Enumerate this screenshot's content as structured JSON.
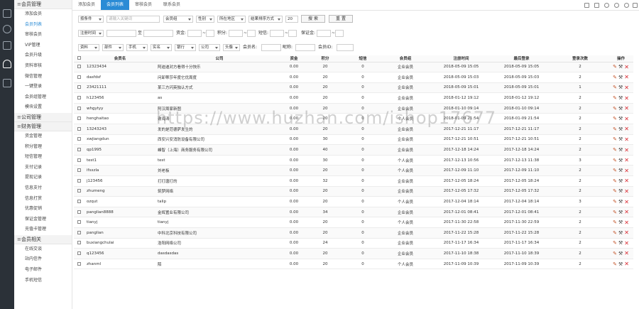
{
  "sidebar": {
    "groups": [
      {
        "label": "会员管理",
        "items": [
          "添加会员",
          "会员列表",
          "审核会员",
          "VIP管理",
          "会员升级",
          "资料审核",
          "微信管理",
          "一键登录",
          "会员组管理",
          "模块设置"
        ]
      },
      {
        "label": "公司管理",
        "items": []
      },
      {
        "label": "财务管理",
        "items": [
          "资金管理",
          "积分管理",
          "短信管理",
          "支付记录",
          "提现记录",
          "信息支付",
          "信息打赏",
          "优惠促销",
          "保证金管理",
          "充值卡管理"
        ]
      },
      {
        "label": "会员相关",
        "items": [
          "在线交谈",
          "站内信件",
          "电子邮件",
          "手机短信"
        ]
      }
    ],
    "active_item": "会员列表"
  },
  "topbar": {
    "tabs": [
      "添加会员",
      "会员列表",
      "审核会员",
      "联系会员"
    ],
    "active_tab": "会员列表",
    "icons": [
      "home-icon",
      "open-icon",
      "refresh-icon",
      "search-icon",
      "help-icon",
      "exit-icon"
    ]
  },
  "filters": {
    "row1": {
      "condition": "按条件",
      "keyword_placeholder": "请输入关键词",
      "group": "会员组",
      "gender": "性别",
      "region": "所在地区",
      "sort": "结果排序方式",
      "pagesize": "20",
      "search_btn": "搜 索",
      "reset_btn": "重 置"
    },
    "row2": {
      "time": "注册时间",
      "to": "至",
      "funds": "资金:",
      "points": "积分:",
      "sms": "短信:",
      "deposit": "保证金:",
      "tilde": "~"
    },
    "row3": {
      "selects": [
        "资料",
        "部件",
        "手机",
        "实名",
        "银行",
        "公司",
        "头像"
      ],
      "member_name": "会员名:",
      "nickname": "昵称:",
      "member_id": "会员ID:"
    }
  },
  "table": {
    "headers": [
      "",
      "会员名",
      "公司",
      "资金",
      "积分",
      "短信",
      "会员组",
      "注册时间",
      "最后登录",
      "登录次数",
      "操作"
    ],
    "rows": [
      [
        "12323434",
        "阿迪迪对方看得十分快乐",
        "0.00",
        "20",
        "0",
        "企业会员",
        "2018-05-09 15:05",
        "2018-05-09 15:05",
        "2"
      ],
      [
        "dasfdsf",
        "问卸蒂莎年度它优周度",
        "0.00",
        "20",
        "0",
        "企业会员",
        "2018-05-09 15:03",
        "2018-05-09 15:03",
        "2"
      ],
      [
        "23421111",
        "某三方闪英独认方式",
        "0.00",
        "20",
        "0",
        "企业会员",
        "2018-05-09 15:01",
        "2018-05-09 15:01",
        "1"
      ],
      [
        "h123456",
        "as",
        "0.00",
        "20",
        "0",
        "企业会员",
        "2018-01-12 19:12",
        "2018-01-12 19:12",
        "2"
      ],
      [
        "whgytyy",
        "阿汉周家新图",
        "0.00",
        "20",
        "0",
        "企业会员",
        "2018-01-10 09:14",
        "2018-01-10 09:14",
        "2"
      ],
      [
        "henghaitao",
        "谢海涛",
        "0.00",
        "20",
        "0",
        "个人会员",
        "2018-01-09 21:54",
        "2018-01-09 21:54",
        "2"
      ],
      [
        "13243243",
        "发的是范德萨发生的",
        "0.00",
        "20",
        "0",
        "企业会员",
        "2017-12-21 11:17",
        "2017-12-21 11:17",
        "2"
      ],
      [
        "xwjiangdun",
        "西安兴安消防设备有限公司",
        "0.00",
        "30",
        "0",
        "企业会员",
        "2017-12-21 10:51",
        "2017-12-21 10:51",
        "2"
      ],
      [
        "qp1995",
        "峰智（上海）商务服务有限公司",
        "0.00",
        "40",
        "0",
        "企业会员",
        "2017-12-18 14:24",
        "2017-12-18 14:24",
        "2"
      ],
      [
        "test1",
        "test",
        "0.00",
        "30",
        "0",
        "个人会员",
        "2017-12-13 10:56",
        "2017-12-13 11:38",
        "3"
      ],
      [
        "ifsxzla",
        "刘老板",
        "0.00",
        "20",
        "0",
        "个人会员",
        "2017-12-09 11:10",
        "2017-12-09 11:10",
        "2"
      ],
      [
        "j123456",
        "打打唐打的",
        "0.00",
        "32",
        "0",
        "企业会员",
        "2017-12-05 18:24",
        "2017-12-05 18:24",
        "2"
      ],
      [
        "zhumeng",
        "筑梦网络",
        "0.00",
        "20",
        "0",
        "企业会员",
        "2017-12-05 17:32",
        "2017-12-05 17:32",
        "2"
      ],
      [
        "ozqut",
        "talip",
        "0.00",
        "20",
        "0",
        "个人会员",
        "2017-12-04 18:14",
        "2017-12-04 18:14",
        "3"
      ],
      [
        "panglian8888",
        "金辉置业有限公司",
        "0.00",
        "34",
        "0",
        "企业会员",
        "2017-12-01 08:41",
        "2017-12-01 08:41",
        "2"
      ],
      [
        "tianyj",
        "tianyj",
        "0.00",
        "20",
        "0",
        "个人会员",
        "2017-11-30 22:58",
        "2017-11-30 22:59",
        "2"
      ],
      [
        "panglian",
        "中科北京科技有限公司",
        "0.00",
        "20",
        "0",
        "企业会员",
        "2017-11-22 15:28",
        "2017-11-22 15:28",
        "2"
      ],
      [
        "buxiangchulai",
        "浩阳网络公司",
        "0.00",
        "24",
        "0",
        "企业会员",
        "2017-11-17 16:34",
        "2017-11-17 16:34",
        "2"
      ],
      [
        "q123456",
        "dasdasdas",
        "0.00",
        "20",
        "0",
        "企业会员",
        "2017-11-10 18:38",
        "2017-11-10 18:39",
        "2"
      ],
      [
        "zhanml",
        "陌",
        "0.00",
        "20",
        "0",
        "个人会员",
        "2017-11-09 10:39",
        "2017-11-09 10:39",
        "2"
      ]
    ]
  },
  "watermark": "https://www.huzhan.com/ishop17677",
  "colors": {
    "accent": "#2a8bd5",
    "sidebar_dark": "#2b3138",
    "delete": "#d9272e",
    "edit": "#c4552a"
  }
}
